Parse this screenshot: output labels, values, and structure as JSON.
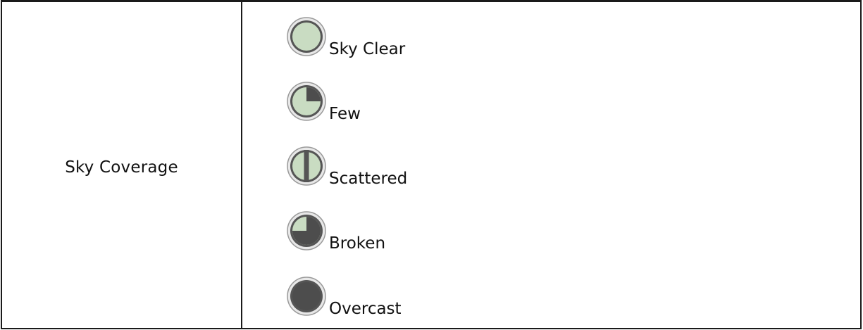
{
  "table": {
    "label": "Sky Coverage",
    "items": [
      {
        "label": "Sky Clear",
        "icon": "sky-clear-icon",
        "fraction": 0
      },
      {
        "label": "Few",
        "icon": "few-icon",
        "fraction": 0.25
      },
      {
        "label": "Scattered",
        "icon": "scattered-icon",
        "fraction": 0.5
      },
      {
        "label": "Broken",
        "icon": "broken-icon",
        "fraction": 0.75
      },
      {
        "label": "Overcast",
        "icon": "overcast-icon",
        "fraction": 1
      }
    ]
  },
  "colors": {
    "fill_light": "#c9dcc2",
    "fill_dark": "#4d4d4d",
    "ring_outer": "#9a9a9a",
    "ring_inner": "#555555"
  }
}
